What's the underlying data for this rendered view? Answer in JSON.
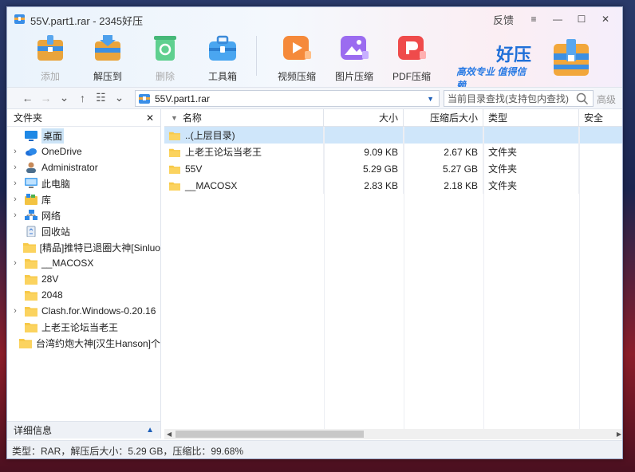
{
  "window": {
    "title": "55V.part1.rar - 2345好压"
  },
  "controls": {
    "feedback": "反馈",
    "menu_icon": "≡",
    "minimize_icon": "—",
    "maximize_icon": "☐",
    "close_icon": "✕"
  },
  "toolbar": [
    {
      "label": "添加",
      "icon": "add-archive-icon",
      "disabled": true
    },
    {
      "label": "解压到",
      "icon": "extract-icon",
      "disabled": false
    },
    {
      "label": "删除",
      "icon": "recycle-icon",
      "disabled": true
    },
    {
      "label": "工具箱",
      "icon": "toolbox-icon",
      "disabled": false
    },
    {
      "label": "视频压缩",
      "icon": "video-compress-icon",
      "disabled": false
    },
    {
      "label": "图片压缩",
      "icon": "image-compress-icon",
      "disabled": false
    },
    {
      "label": "PDF压缩",
      "icon": "pdf-compress-icon",
      "disabled": false
    }
  ],
  "brand": {
    "name": "好压",
    "slogan": "高效专业 值得信赖"
  },
  "address": {
    "path": "55V.part1.rar",
    "search_placeholder": "当前目录查找(支持包内查找)",
    "advanced": "高级"
  },
  "sidebar": {
    "title": "文件夹",
    "items": [
      {
        "label": "桌面",
        "icon": "desktop-icon",
        "expandable": false,
        "selected": true
      },
      {
        "label": "OneDrive",
        "icon": "cloud-icon",
        "expandable": true
      },
      {
        "label": "Administrator",
        "icon": "user-icon",
        "expandable": true
      },
      {
        "label": "此电脑",
        "icon": "computer-icon",
        "expandable": true
      },
      {
        "label": "库",
        "icon": "library-icon",
        "expandable": true
      },
      {
        "label": "网络",
        "icon": "network-icon",
        "expandable": true
      },
      {
        "label": "回收站",
        "icon": "recycle-bin-icon",
        "expandable": false
      },
      {
        "label": "[精品]推特已退圈大神[Sinluo",
        "icon": "folder-icon",
        "expandable": false
      },
      {
        "label": "__MACOSX",
        "icon": "folder-icon",
        "expandable": true
      },
      {
        "label": "28V",
        "icon": "folder-icon",
        "expandable": false
      },
      {
        "label": "2048",
        "icon": "folder-icon",
        "expandable": false
      },
      {
        "label": "Clash.for.Windows-0.20.16",
        "icon": "folder-icon",
        "expandable": true
      },
      {
        "label": "上老王论坛当老王",
        "icon": "folder-icon",
        "expandable": false
      },
      {
        "label": "台湾约炮大神[汉生Hanson]个",
        "icon": "folder-icon",
        "expandable": false
      }
    ],
    "details_label": "详细信息"
  },
  "filelist": {
    "columns": {
      "name": "名称",
      "size": "大小",
      "compressed": "压缩后大小",
      "type": "类型",
      "security": "安全"
    },
    "rows": [
      {
        "name": "..(上层目录)",
        "size": "",
        "compressed": "",
        "type": "",
        "up": true
      },
      {
        "name": "上老王论坛当老王",
        "size": "9.09 KB",
        "compressed": "2.67 KB",
        "type": "文件夹"
      },
      {
        "name": "55V",
        "size": "5.29 GB",
        "compressed": "5.27 GB",
        "type": "文件夹"
      },
      {
        "name": "__MACOSX",
        "size": "2.83 KB",
        "compressed": "2.18 KB",
        "type": "文件夹"
      }
    ]
  },
  "status": {
    "text": "类型：RAR，解压后大小：5.29 GB，压缩比：99.68%"
  },
  "colors": {
    "accent": "#1e6fd9",
    "selection": "#cfe6fa",
    "folder": "#f7c948"
  }
}
